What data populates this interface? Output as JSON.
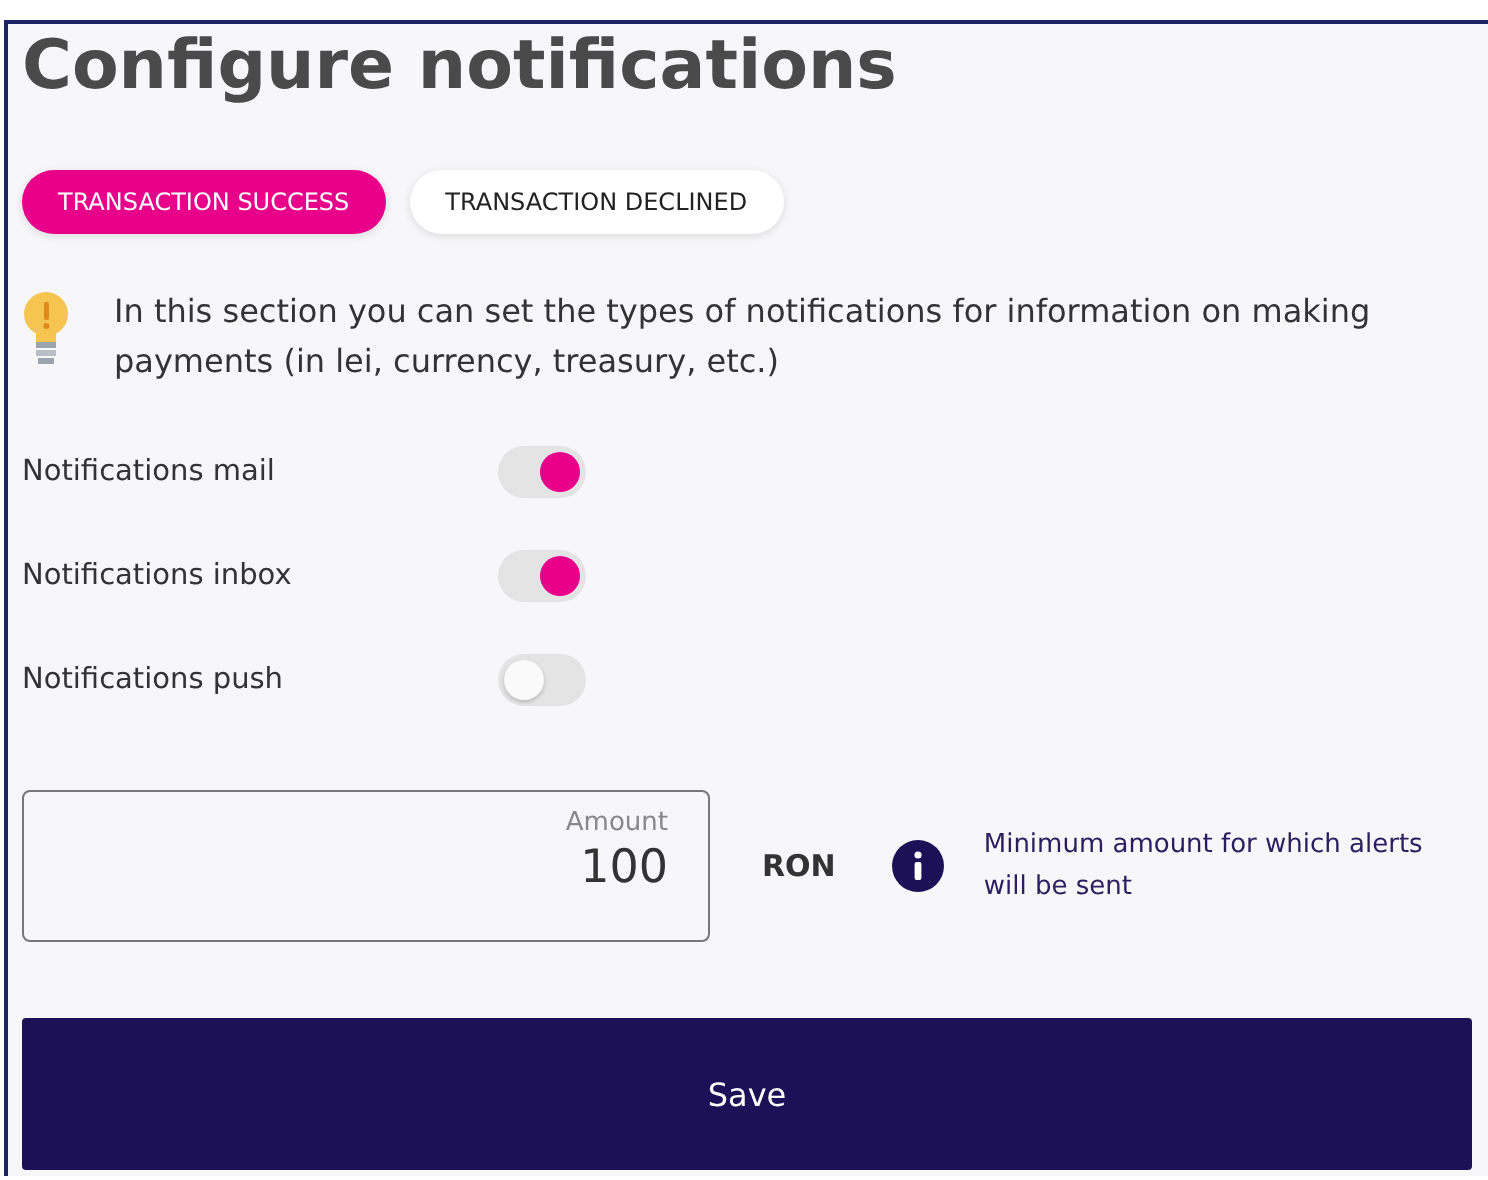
{
  "title": "Configure notifications",
  "tabs": [
    {
      "label": "TRANSACTION SUCCESS",
      "selected": true
    },
    {
      "label": "TRANSACTION DECLINED",
      "selected": false
    }
  ],
  "tip": "In this section you can set the types of notifications for information on making payments (in lei, currency, treasury, etc.)",
  "toggles": [
    {
      "label": "Notifications mail",
      "on": true
    },
    {
      "label": "Notifications inbox",
      "on": true
    },
    {
      "label": "Notifications push",
      "on": false
    }
  ],
  "amount": {
    "label": "Amount",
    "value": "100",
    "currency": "RON",
    "hint": "Minimum amount for which alerts will be sent"
  },
  "save_button": "Save"
}
